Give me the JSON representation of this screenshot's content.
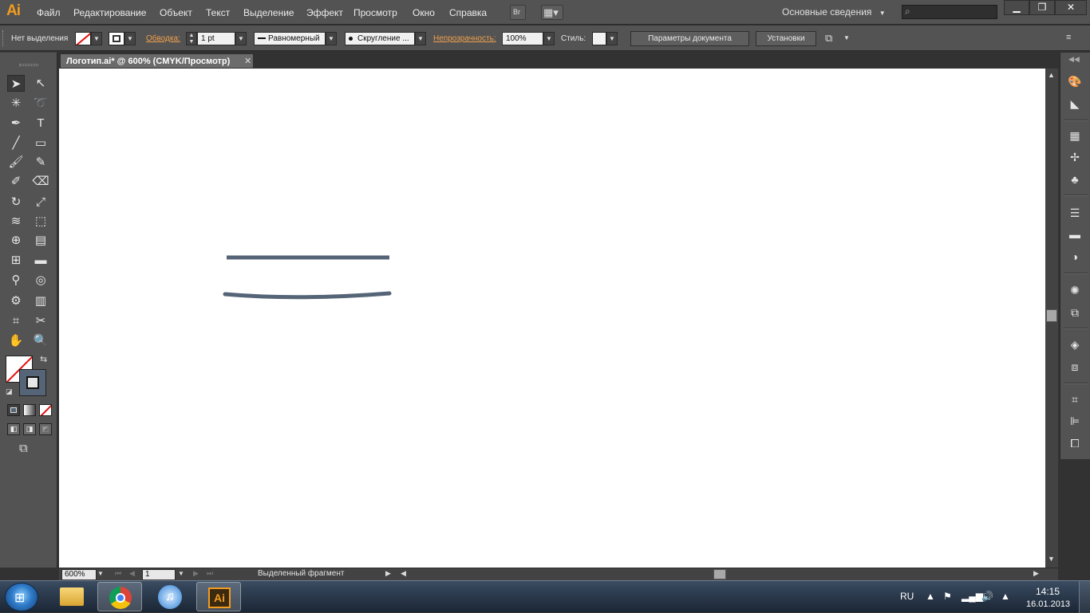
{
  "app": {
    "logo": "Ai",
    "accent_color": "#f29c1f"
  },
  "menubar": {
    "items": [
      "Файл",
      "Редактирование",
      "Объект",
      "Текст",
      "Выделение",
      "Эффект",
      "Просмотр",
      "Окно",
      "Справка"
    ],
    "bridge_label": "Br",
    "workspace": "Основные сведения"
  },
  "control_bar": {
    "selection_status": "Нет выделения",
    "stroke_label": "Обводка:",
    "stroke_weight": "1 pt",
    "stroke_profile": "Равномерный",
    "brush": "Скругление ...",
    "opacity_label": "Непрозрачность:",
    "opacity_value": "100%",
    "style_label": "Стиль:",
    "doc_setup_button": "Параметры документа",
    "preferences_button": "Установки"
  },
  "document": {
    "tab_title": "Логотип.ai* @ 600% (CMYK/Просмотр)",
    "stroke_color": "#556577"
  },
  "statusbar": {
    "zoom": "600%",
    "artboard": "1",
    "status_text": "Выделенный фрагмент"
  },
  "taskbar": {
    "language": "RU",
    "time": "14:15",
    "date": "16.01.2013"
  }
}
